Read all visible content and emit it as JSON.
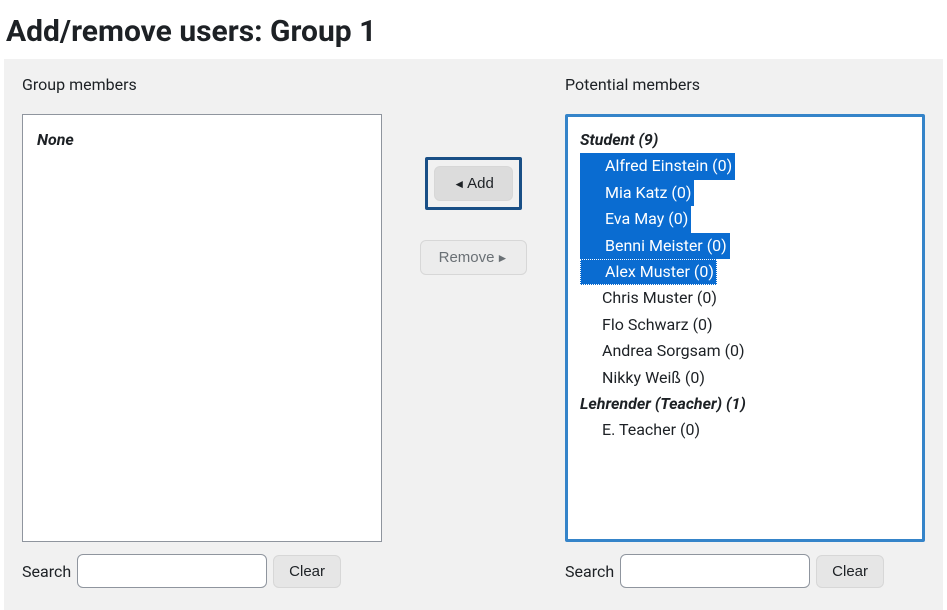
{
  "title": "Add/remove users: Group 1",
  "left": {
    "header": "Group members",
    "none_label": "None",
    "search_label": "Search",
    "search_value": "",
    "clear_label": "Clear"
  },
  "center": {
    "add_label": "Add",
    "remove_label": "Remove"
  },
  "right": {
    "header": "Potential members",
    "groups": [
      {
        "label": "Student (9)",
        "items": [
          {
            "text": "Alfred Einstein (0)",
            "selected": true
          },
          {
            "text": "Mia Katz (0)",
            "selected": true
          },
          {
            "text": "Eva May (0)",
            "selected": true
          },
          {
            "text": "Benni Meister (0)",
            "selected": true
          },
          {
            "text": "Alex Muster (0)",
            "selected": true,
            "last": true
          },
          {
            "text": "Chris Muster (0)",
            "selected": false
          },
          {
            "text": "Flo Schwarz (0)",
            "selected": false
          },
          {
            "text": "Andrea Sorgsam (0)",
            "selected": false
          },
          {
            "text": "Nikky Weiß (0)",
            "selected": false
          }
        ]
      },
      {
        "label": "Lehrender (Teacher) (1)",
        "items": [
          {
            "text": "E. Teacher (0)",
            "selected": false
          }
        ]
      }
    ],
    "search_label": "Search",
    "search_value": "",
    "clear_label": "Clear"
  }
}
